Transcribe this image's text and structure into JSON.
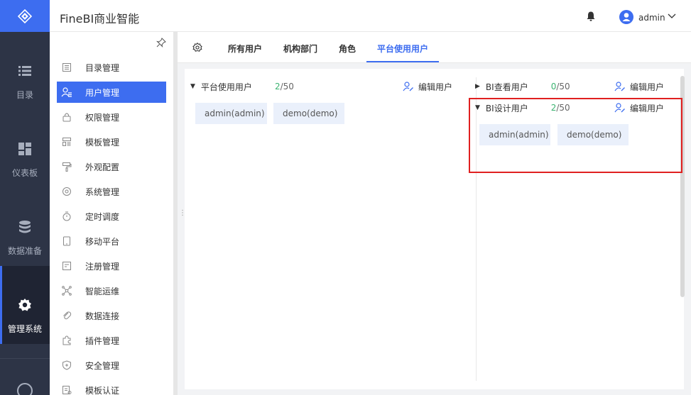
{
  "app": {
    "title": "FineBI商业智能"
  },
  "header": {
    "user_name": "admin"
  },
  "nav": {
    "items": [
      {
        "label": "目录",
        "icon": "list-icon"
      },
      {
        "label": "仪表板",
        "icon": "dashboard-icon"
      },
      {
        "label": "数据准备",
        "icon": "database-icon"
      },
      {
        "label": "管理系统",
        "icon": "gear-icon",
        "active": true
      }
    ]
  },
  "sidebar": {
    "items": [
      {
        "label": "目录管理",
        "icon": "catalog-icon"
      },
      {
        "label": "用户管理",
        "icon": "user-manage-icon",
        "active": true
      },
      {
        "label": "权限管理",
        "icon": "lock-icon"
      },
      {
        "label": "模板管理",
        "icon": "template-icon"
      },
      {
        "label": "外观配置",
        "icon": "paint-roller-icon"
      },
      {
        "label": "系统管理",
        "icon": "settings-icon"
      },
      {
        "label": "定时调度",
        "icon": "timer-icon"
      },
      {
        "label": "移动平台",
        "icon": "mobile-icon"
      },
      {
        "label": "注册管理",
        "icon": "register-icon"
      },
      {
        "label": "智能运维",
        "icon": "network-icon"
      },
      {
        "label": "数据连接",
        "icon": "link-icon"
      },
      {
        "label": "插件管理",
        "icon": "puzzle-icon"
      },
      {
        "label": "安全管理",
        "icon": "shield-icon"
      },
      {
        "label": "模板认证",
        "icon": "certify-icon"
      }
    ]
  },
  "tabs": [
    {
      "label": "所有用户"
    },
    {
      "label": "机构部门"
    },
    {
      "label": "角色"
    },
    {
      "label": "平台使用用户",
      "active": true
    }
  ],
  "groups": {
    "platform": {
      "name": "平台使用用户",
      "used": "2",
      "total": "/50",
      "edit_label": "编辑用户",
      "members": [
        "admin(admin)",
        "demo(demo)"
      ]
    },
    "bi_view": {
      "name": "BI查看用户",
      "used": "0",
      "total": "/50",
      "edit_label": "编辑用户"
    },
    "bi_design": {
      "name": "BI设计用户",
      "used": "2",
      "total": "/50",
      "edit_label": "编辑用户",
      "members": [
        "admin(admin)",
        "demo(demo)"
      ]
    }
  },
  "colors": {
    "accent": "#3d6df0",
    "nav_bg": "#2d3446",
    "count_green": "#3cb371",
    "highlight_red": "#e02020",
    "chip_bg": "#eaf0fb"
  }
}
